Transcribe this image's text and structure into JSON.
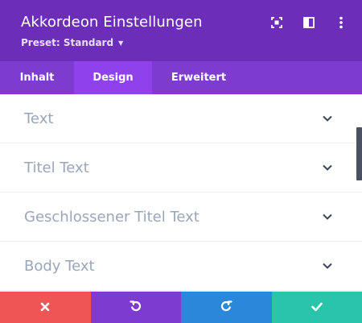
{
  "header": {
    "title": "Akkordeon Einstellungen",
    "preset_label": "Preset: Standard",
    "icons": [
      "fullscreen-icon",
      "columns-icon",
      "more-options-icon"
    ]
  },
  "tabs": [
    {
      "label": "Inhalt",
      "active": false
    },
    {
      "label": "Design",
      "active": true
    },
    {
      "label": "Erweitert",
      "active": false
    }
  ],
  "sections": [
    {
      "label": "Text"
    },
    {
      "label": "Titel Text"
    },
    {
      "label": "Geschlossener Titel Text"
    },
    {
      "label": "Body Text"
    }
  ],
  "footer": {
    "buttons": [
      {
        "name": "cancel",
        "icon": "close-icon",
        "color": "#ef5555"
      },
      {
        "name": "undo",
        "icon": "undo-icon",
        "color": "#7e3bd0"
      },
      {
        "name": "redo",
        "icon": "redo-icon",
        "color": "#2b87da"
      },
      {
        "name": "save",
        "icon": "check-icon",
        "color": "#29c4a9"
      }
    ]
  },
  "colors": {
    "header_bg": "#6c2eb9",
    "tabs_bg": "#7e3bd0",
    "active_tab_bg": "#8f42ec",
    "section_text": "#9aa6b8"
  }
}
